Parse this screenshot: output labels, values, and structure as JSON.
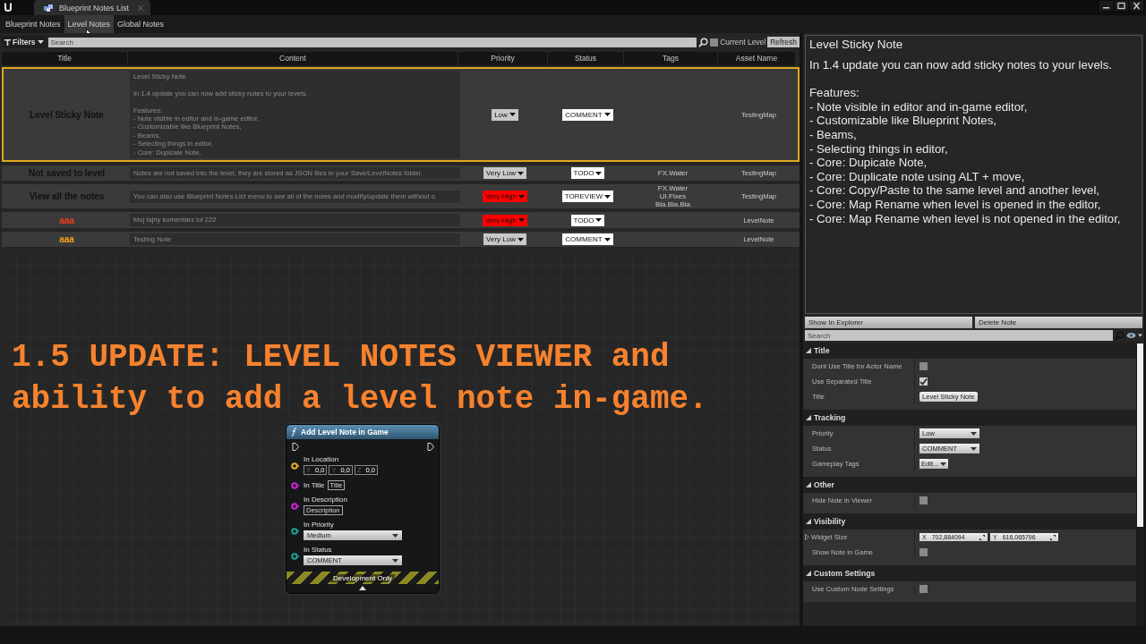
{
  "window": {
    "tab_title": "Blueprint Notes List"
  },
  "tabs": [
    {
      "label": "Blueprint Notes",
      "selected": false
    },
    {
      "label": "Level Notes",
      "selected": true
    },
    {
      "label": "Global Notes",
      "selected": false
    }
  ],
  "filter_bar": {
    "filters_label": "Filters",
    "search": {
      "placeholder": "Search"
    },
    "current_level": {
      "label": "Current Level",
      "checked": false
    },
    "refresh": "Refresh"
  },
  "table": {
    "columns": [
      "Title",
      "Content",
      "Priority",
      "Status",
      "Tags",
      "Asset Name"
    ],
    "rows": [
      {
        "title": "Level Sticky Note",
        "color": "#111111",
        "selected": true,
        "content": "Level Sticky Note\n\nIn 1.4 update you can now add sticky notes to your levels.\n\nFeatures:\n- Note visible in editor and in-game editor,\n- Customizable like Blueprint Notes,\n- Beams,\n- Selecting things in editor,\n- Core: Dupicate Note,",
        "priority": {
          "label": "Low",
          "color": "#c8c8c8"
        },
        "status": "COMMENT",
        "asset_name": "TestingMap"
      },
      {
        "title": "Not saved to level",
        "color": "#111111",
        "selected": false,
        "content": "Notes are not saved into the level, they are stored as JSON files in your Save/LevelNotes folder.",
        "priority": {
          "label": "Very Low",
          "color": "#c8c8c8"
        },
        "status": "TODO",
        "tags": [
          "FX.Water"
        ],
        "asset_name": "TestingMap"
      },
      {
        "title": "View all the notes",
        "color": "#111111",
        "selected": false,
        "content": "You can also use Blueprint Notes List menu to see all of the notes and modify/update them without o",
        "priority": {
          "label": "Very High",
          "color": "#ff0000"
        },
        "status": "TOREVIEW",
        "tags": [
          "FX.Water",
          "UI.Fixes",
          "Bla.Bla.Bla"
        ],
        "asset_name": "TestingMap"
      },
      {
        "title": "aaa",
        "color": "#f0401a",
        "selected": false,
        "content": "Moj fajny komentarz lol 222",
        "priority": {
          "label": "Very High",
          "color": "#ff0000"
        },
        "status": "TODO",
        "asset_name": "LevelNote"
      },
      {
        "title": "aaa",
        "color": "#f5a81a",
        "selected": false,
        "content": "Testing Note",
        "priority": {
          "label": "Very Low",
          "color": "#c8c8c8"
        },
        "status": "COMMENT",
        "asset_name": "LevelNote"
      }
    ]
  },
  "banner": "1.5 UPDATE: LEVEL NOTES VIEWER and ability to add a level note in-game.",
  "node": {
    "title": "Add Level Note in Game",
    "pins": [
      {
        "label": "In Location",
        "kind": "vector",
        "color": "#e0b030",
        "fields": [
          {
            "axis": "X",
            "value": "0,0"
          },
          {
            "axis": "Y",
            "value": "0,0"
          },
          {
            "axis": "Z",
            "value": "0,0"
          }
        ]
      },
      {
        "label": "In Title",
        "kind": "inline-text",
        "color": "#d020d0",
        "value": "Title"
      },
      {
        "label": "In Description",
        "kind": "text",
        "color": "#d020d0",
        "value": "Description"
      },
      {
        "label": "In Priority",
        "kind": "dropdown",
        "color": "#20a090",
        "value": "Medium"
      },
      {
        "label": "In Status",
        "kind": "dropdown",
        "color": "#20a090",
        "value": "COMMENT"
      }
    ],
    "footer": "Development Only"
  },
  "preview": {
    "title": "Level Sticky Note",
    "body": "In 1.4 update you can now add sticky notes to your levels.\n\nFeatures:\n- Note visible in editor and in-game editor,\n- Customizable like Blueprint Notes,\n- Beams,\n- Selecting things in editor,\n- Core: Dupicate Note,\n- Core: Duplicate note using ALT + move,\n- Core: Copy/Paste to the same level and another level,\n- Core: Map Rename when level is opened in the editor,\n- Core: Map Rename when level is not opened in the editor,"
  },
  "actions": [
    "Show In Explorer",
    "Delete Note"
  ],
  "details": {
    "search": {
      "placeholder": "Search"
    },
    "sections": [
      {
        "title": "Title",
        "expanded": true,
        "rows": [
          {
            "label": "Dont Use Title for Actor Name",
            "kind": "checkbox",
            "checked": false
          },
          {
            "label": "Use Separated Title",
            "kind": "checkbox",
            "checked": true
          },
          {
            "label": "Title",
            "kind": "text",
            "value": "Level Sticky Note"
          }
        ]
      },
      {
        "title": "Tracking",
        "expanded": true,
        "rows": [
          {
            "label": "Priority",
            "kind": "dropdown",
            "value": "Low"
          },
          {
            "label": "Status",
            "kind": "dropdown",
            "value": "COMMENT"
          },
          {
            "label": "Gameplay Tags",
            "kind": "menu",
            "value": "Edit..."
          }
        ]
      },
      {
        "title": "Other",
        "expanded": true,
        "rows": [
          {
            "label": "Hide Note in Viewer",
            "kind": "checkbox",
            "checked": false
          }
        ]
      },
      {
        "title": "Visibility",
        "expanded": true,
        "rows": [
          {
            "label": "Widget Size",
            "kind": "vector",
            "fields": [
              {
                "axis": "X",
                "value": "702,884094"
              },
              {
                "axis": "Y",
                "value": "616,065796"
              }
            ]
          },
          {
            "label": "Show Note in Game",
            "kind": "checkbox",
            "checked": false
          }
        ]
      },
      {
        "title": "Custom Settings",
        "expanded": true,
        "rows": [
          {
            "label": "Use Custom Node Settings",
            "kind": "checkbox",
            "checked": false
          }
        ]
      }
    ]
  }
}
